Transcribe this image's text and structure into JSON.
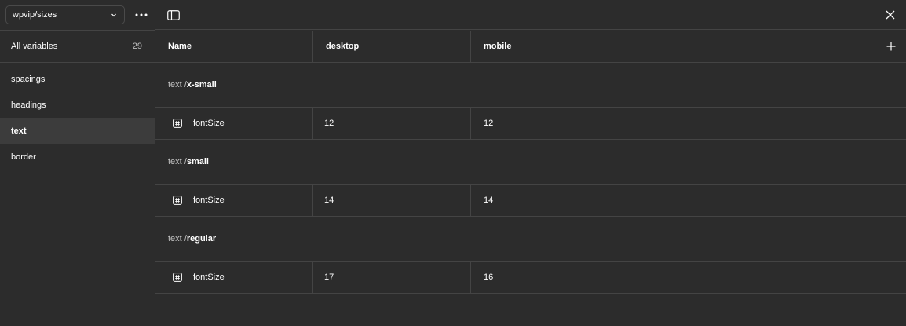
{
  "sidebar": {
    "collection": "wpvip/sizes",
    "all_variables_label": "All variables",
    "all_variables_count": "29",
    "groups": [
      {
        "label": "spacings"
      },
      {
        "label": "headings"
      },
      {
        "label": "text",
        "active": true
      },
      {
        "label": "border"
      }
    ]
  },
  "table": {
    "columns": [
      "Name",
      "desktop",
      "mobile"
    ],
    "sections": [
      {
        "prefix": "text / ",
        "name": "x-small",
        "rows": [
          {
            "icon": "number-icon",
            "name": "fontSize",
            "desktop": "12",
            "mobile": "12"
          }
        ]
      },
      {
        "prefix": "text / ",
        "name": "small",
        "rows": [
          {
            "icon": "number-icon",
            "name": "fontSize",
            "desktop": "14",
            "mobile": "14"
          }
        ]
      },
      {
        "prefix": "text / ",
        "name": "regular",
        "rows": [
          {
            "icon": "number-icon",
            "name": "fontSize",
            "desktop": "17",
            "mobile": "16"
          }
        ]
      }
    ]
  },
  "colors": {
    "background": "#2c2c2c",
    "border": "#444444",
    "active": "#3c3c3c",
    "text": "#ffffff",
    "muted": "#c4c4c4"
  }
}
